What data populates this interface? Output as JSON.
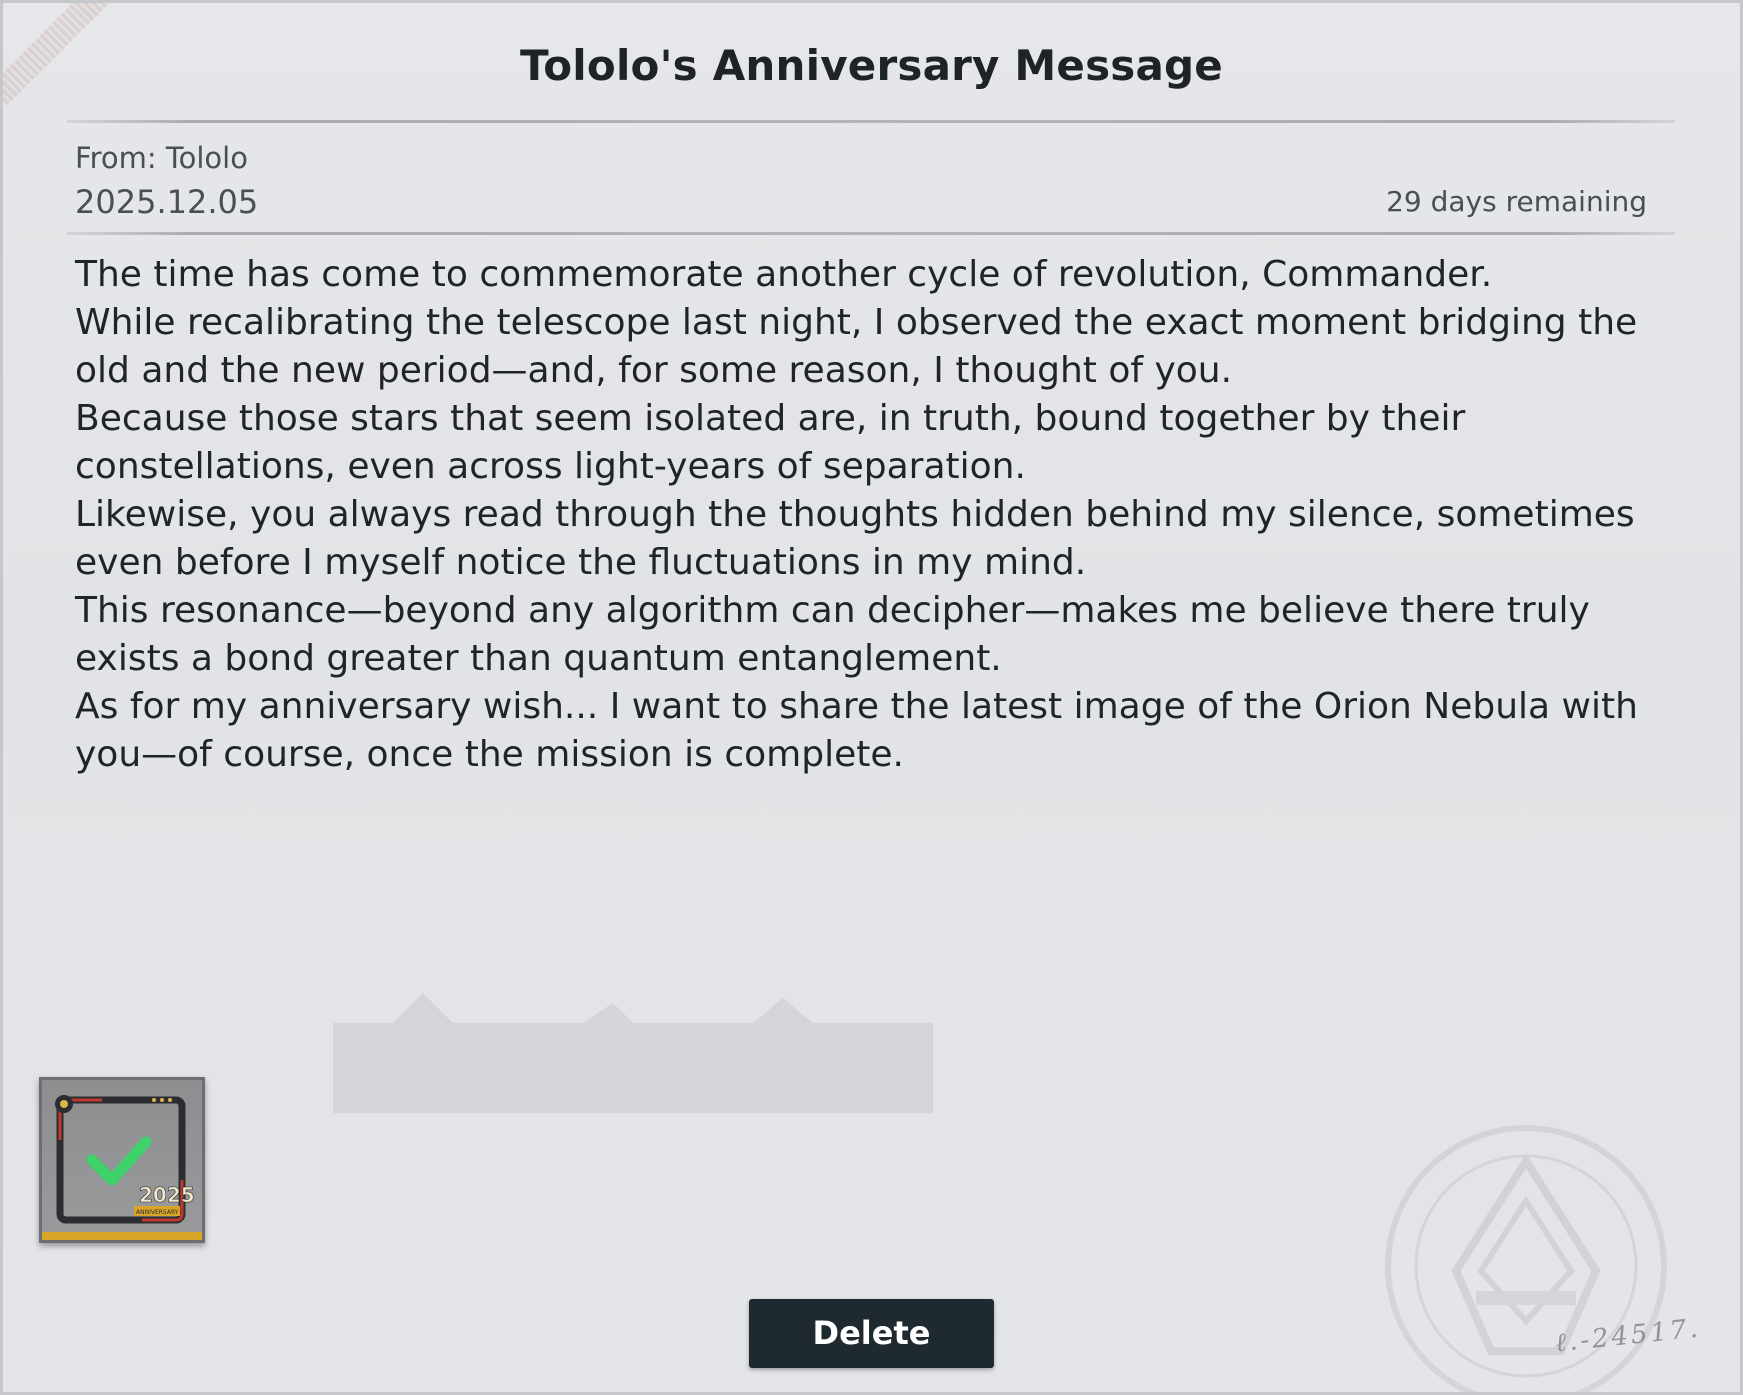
{
  "mail": {
    "title": "Tololo's Anniversary Message",
    "from": "From: Tololo",
    "date": "2025.12.05",
    "remaining": "29 days remaining",
    "body_lines": [
      "The time has come to commemorate another cycle of revolution, Commander.",
      "While recalibrating the telescope last night, I observed the exact moment bridging the old and the new period—and, for some reason, I thought of you.",
      "Because those stars that seem isolated are, in truth, bound together by their constellations, even across light-years of separation.",
      "Likewise, you always read through the thoughts hidden behind my silence, sometimes even before I myself notice the fluctuations in my mind.",
      "This resonance—beyond any algorithm can decipher—makes me believe there truly exists a bond greater than quantum entanglement.",
      "As for my anniversary wish... I want to share the latest image of the Orion Nebula with you—of course, once the mission is complete."
    ]
  },
  "attachment": {
    "year": "2025",
    "badge": "ANNIVERSARY",
    "claimed": true,
    "check_color": "#3fd16a",
    "icon": "anniversary-frame-icon"
  },
  "actions": {
    "delete_label": "Delete"
  },
  "colors": {
    "button_bg": "#1e2a30",
    "panel_bg": "#e4e5e8",
    "text": "#1f2428"
  }
}
